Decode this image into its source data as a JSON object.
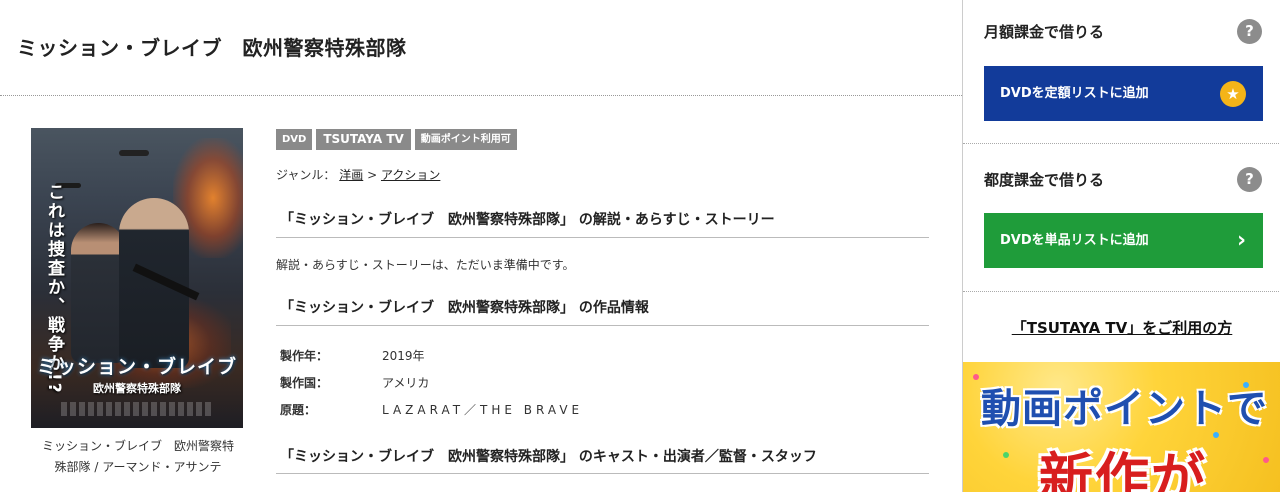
{
  "page_title": "ミッション・ブレイブ　欧州警察特殊部隊",
  "poster": {
    "vertical_catch": "これは捜査か、戦争か!?",
    "title": "ミッション・ブレイブ",
    "subtitle": "欧州警察特殊部隊"
  },
  "caption": {
    "line1": "ミッション・ブレイブ　欧州警察特",
    "line2": "殊部隊 / アーマンド・アサンテ"
  },
  "badges": [
    "DVD",
    "TSUTAYA TV",
    "動画ポイント利用可"
  ],
  "genre": {
    "label": "ジャンル：",
    "item1": "洋画",
    "separator": ">",
    "item2": "アクション"
  },
  "sections": {
    "synopsis_heading": "「ミッション・ブレイブ　欧州警察特殊部隊」 の解説・あらすじ・ストーリー",
    "synopsis_text": "解説・あらすじ・ストーリーは、ただいま準備中です。",
    "info_heading": "「ミッション・ブレイブ　欧州警察特殊部隊」 の作品情報",
    "cast_heading": "「ミッション・ブレイブ　欧州警察特殊部隊」 のキャスト・出演者／監督・スタッフ"
  },
  "info": [
    {
      "key": "製作年：",
      "value": "2019年"
    },
    {
      "key": "製作国：",
      "value": "アメリカ"
    },
    {
      "key": "原題：",
      "value": "LAZARAT／THE BRAVE"
    }
  ],
  "sidebar": {
    "monthly_heading": "月額課金で借りる",
    "monthly_button": "DVDを定額リストに追加",
    "per_rental_heading": "都度課金で借りる",
    "per_rental_button": "DVDを単品リストに追加",
    "help_glyph": "?",
    "tsutaya_link": "「TSUTAYA TV」をご利用の方",
    "banner_line1": "動画ポイントで",
    "banner_line2": "新作が"
  },
  "colors": {
    "blue_button": "#123b9a",
    "green_button": "#1f9c3a",
    "badge_gray": "#8a8a8a",
    "star_yellow": "#f4b418"
  }
}
